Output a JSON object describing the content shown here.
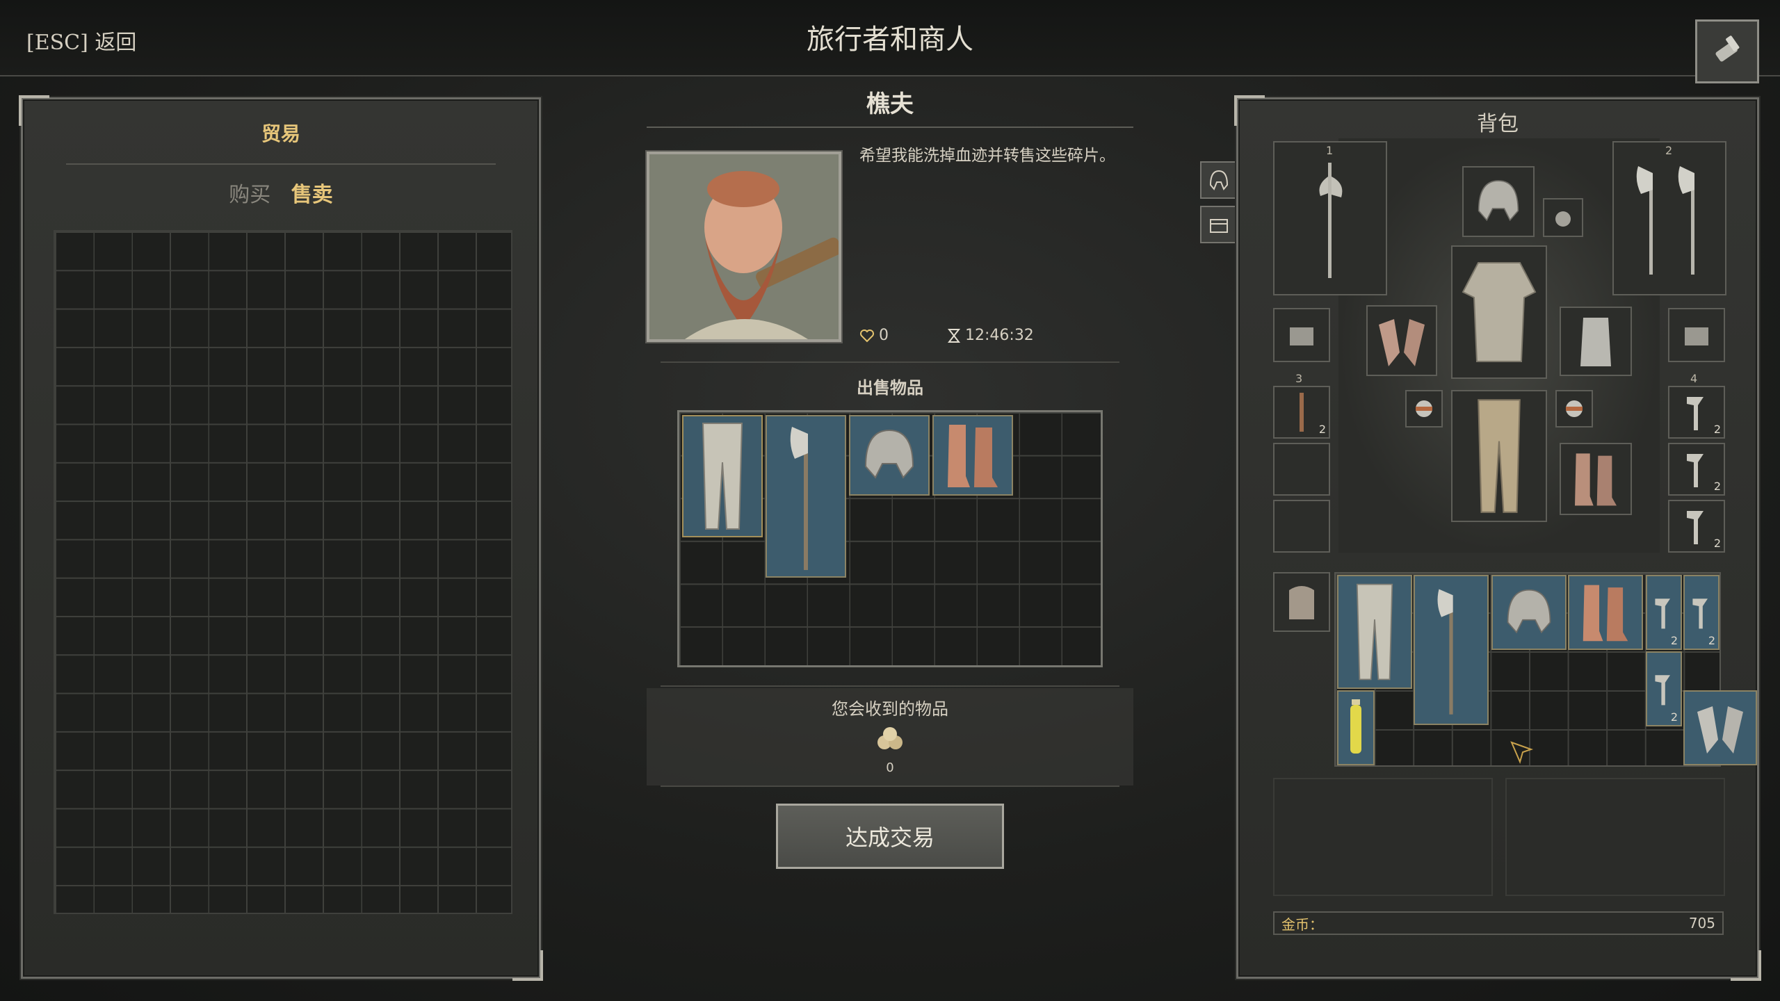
{
  "header": {
    "back_label": "[ESC] 返回",
    "title": "旅行者和商人"
  },
  "trade_panel": {
    "title": "贸易",
    "tabs": [
      {
        "label": "购买"
      },
      {
        "label": "售卖"
      }
    ]
  },
  "npc": {
    "name": "樵夫",
    "quote": "希望我能洗掉血迹并转售这些碎片。",
    "reputation": "0",
    "timer": "12:46:32"
  },
  "sell": {
    "title": "出售物品",
    "items": [
      {
        "icon": "pants-icon"
      },
      {
        "icon": "axe-icon"
      },
      {
        "icon": "helmet-icon"
      },
      {
        "icon": "boots-icon"
      }
    ]
  },
  "receive": {
    "title": "您会收到的物品",
    "icon": "coin-pile-icon",
    "value": "0"
  },
  "deal_button": {
    "label": "达成交易"
  },
  "backpack": {
    "title": "背包",
    "weapon_slots": [
      {
        "number": "1"
      },
      {
        "number": "2"
      },
      {
        "number": "3"
      },
      {
        "number": "4"
      }
    ],
    "stack_count": "2",
    "gold_label": "金币：",
    "gold_value": "705"
  },
  "colors": {
    "accent": "#e7c67a",
    "item_blue": "#3c5a6a",
    "panel": "#2f302d"
  }
}
